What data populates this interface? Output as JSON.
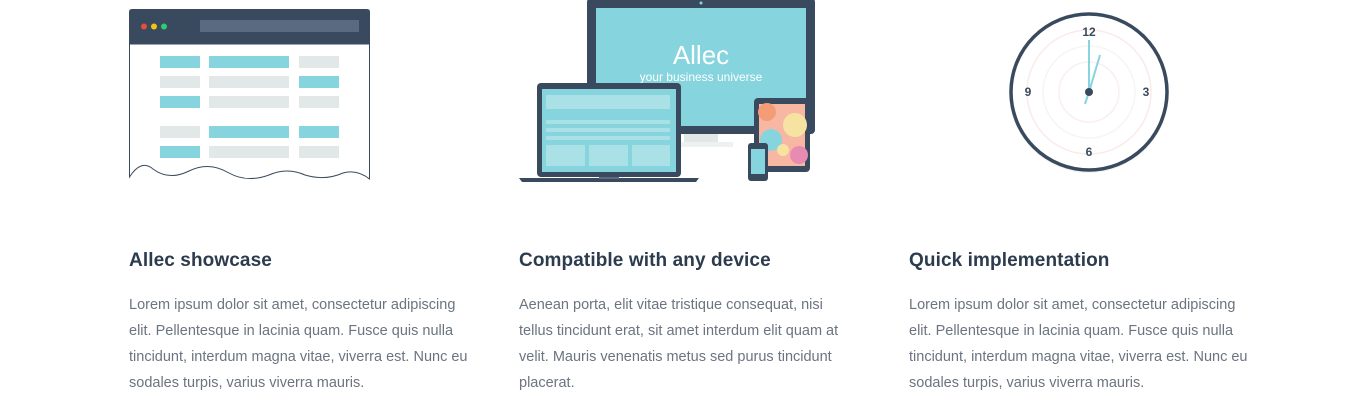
{
  "features": [
    {
      "illustration": "browser-table-icon",
      "title": "Allec showcase",
      "body": "Lorem ipsum dolor sit amet, consectetur adipiscing elit. Pellentesque in lacinia quam. Fusce quis nulla tincidunt, interdum magna vitae, viverra est. Nunc eu sodales turpis, varius viverra mauris."
    },
    {
      "illustration": "devices-icon",
      "title": "Compatible with any device",
      "body": "Aenean porta, elit vitae tristique consequat, nisi tellus tincidunt erat, sit amet interdum elit quam at velit. Mauris venenatis metus sed purus tincidunt placerat.",
      "screen_title": "Allec",
      "screen_tagline": "your business universe"
    },
    {
      "illustration": "clock-icon",
      "title": "Quick implementation",
      "body": "Lorem ipsum dolor sit amet, consectetur adipiscing elit. Pellentesque in lacinia quam. Fusce quis nulla tincidunt, interdum magna vitae, viverra est. Nunc eu sodales turpis, varius viverra mauris.",
      "clock_numbers": {
        "n12": "12",
        "n3": "3",
        "n6": "6",
        "n9": "9"
      }
    }
  ],
  "colors": {
    "dark": "#3a4a5e",
    "accent": "#86d4dd",
    "light_gray": "#e2e7e8",
    "heading": "#2d3b4e",
    "text": "#6b7480"
  }
}
